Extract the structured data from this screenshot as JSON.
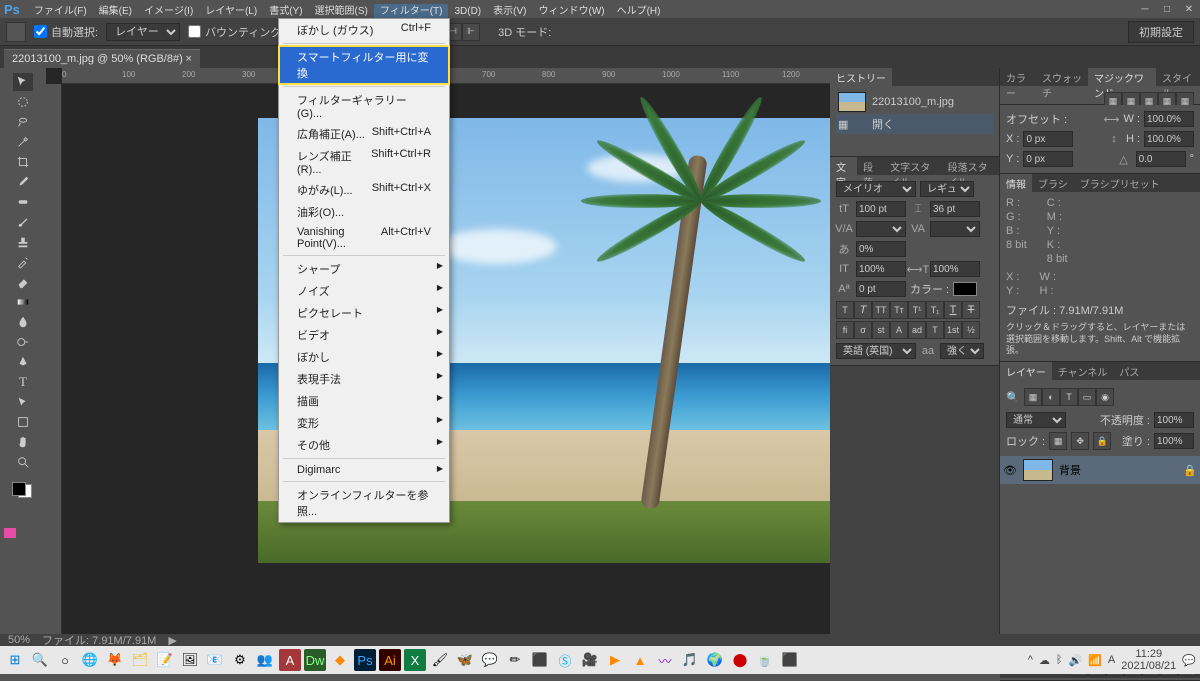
{
  "menubar": {
    "items": [
      "ファイル(F)",
      "編集(E)",
      "イメージ(I)",
      "レイヤー(L)",
      "書式(Y)",
      "選択範囲(S)",
      "フィルター(T)",
      "3D(D)",
      "表示(V)",
      "ウィンドウ(W)",
      "ヘルプ(H)"
    ],
    "active_index": 6
  },
  "optionsbar": {
    "auto_select": "自動選択:",
    "target": "レイヤー",
    "show_bbox": "バウンティングボックスを表示",
    "mode_label": "3D モード:",
    "workspace_label": "初期設定"
  },
  "document": {
    "tab": "22013100_m.jpg @ 50% (RGB/8#)",
    "zoom": "50%",
    "filesize": "ファイル: 7.91M/7.91M"
  },
  "dropdown": {
    "items": [
      {
        "label": "ぼかし (ガウス)",
        "shortcut": "Ctrl+F"
      },
      {
        "sep": true
      },
      {
        "label": "スマートフィルター用に変換",
        "highlighted": true
      },
      {
        "sep": true
      },
      {
        "label": "フィルターギャラリー(G)..."
      },
      {
        "label": "広角補正(A)...",
        "shortcut": "Shift+Ctrl+A"
      },
      {
        "label": "レンズ補正(R)...",
        "shortcut": "Shift+Ctrl+R"
      },
      {
        "label": "ゆがみ(L)...",
        "shortcut": "Shift+Ctrl+X"
      },
      {
        "label": "油彩(O)..."
      },
      {
        "label": "Vanishing Point(V)...",
        "shortcut": "Alt+Ctrl+V"
      },
      {
        "sep": true
      },
      {
        "label": "シャープ",
        "sub": true
      },
      {
        "label": "ノイズ",
        "sub": true
      },
      {
        "label": "ピクセレート",
        "sub": true
      },
      {
        "label": "ビデオ",
        "sub": true
      },
      {
        "label": "ぼかし",
        "sub": true
      },
      {
        "label": "表現手法",
        "sub": true
      },
      {
        "label": "描画",
        "sub": true
      },
      {
        "label": "変形",
        "sub": true
      },
      {
        "label": "その他",
        "sub": true
      },
      {
        "sep": true
      },
      {
        "label": "Digimarc",
        "sub": true
      },
      {
        "sep": true
      },
      {
        "label": "オンラインフィルターを参照..."
      }
    ]
  },
  "panels": {
    "history": {
      "tab": "ヒストリー",
      "file": "22013100_m.jpg",
      "action": "開く"
    },
    "character": {
      "tabs": [
        "文字",
        "段落",
        "文字スタイル",
        "段落スタイル"
      ],
      "font": "メイリオ",
      "style": "レギュ...",
      "size": "100 pt",
      "leading": "36 pt",
      "tracking": "0%",
      "vscale": "100%",
      "hscale": "100%",
      "baseline": "0 pt",
      "color_label": "カラー :",
      "lang": "英語 (英国)",
      "aa": "強く"
    },
    "color": {
      "tabs": [
        "カラー",
        "スウォッチ",
        "マジックワンド",
        "スタイル"
      ]
    },
    "transform": {
      "offset": "オフセット :",
      "w_label": "W :",
      "w": "100.0%",
      "x_label": "X :",
      "x": "0 px",
      "h_label": "H :",
      "h": "100.0%",
      "y_label": "Y :",
      "y": "0 px",
      "angle": "0.0"
    },
    "info": {
      "tabs": [
        "情報",
        "ブラシ",
        "ブラシプリセット"
      ],
      "r": "R :",
      "g": "G :",
      "b": "B :",
      "c": "C :",
      "m": "M :",
      "y": "Y :",
      "k": "K :",
      "bit": "8 bit",
      "bit2": "8 bit",
      "xl": "X :",
      "yl": "Y :",
      "wl": "W :",
      "hl": "H :",
      "filesize": "ファイル : 7.91M/7.91M",
      "hint": "クリック＆ドラッグすると、レイヤーまたは選択範囲を移動します。Shift、Alt で機能拡張。"
    },
    "layers": {
      "tabs": [
        "レイヤー",
        "チャンネル",
        "パス"
      ],
      "blend": "通常",
      "opacity_label": "不透明度 :",
      "opacity": "100%",
      "lock": "ロック :",
      "fill_label": "塗り :",
      "fill": "100%",
      "layer_name": "背景"
    }
  },
  "taskbar": {
    "time": "11:29",
    "date": "2021/08/21"
  }
}
